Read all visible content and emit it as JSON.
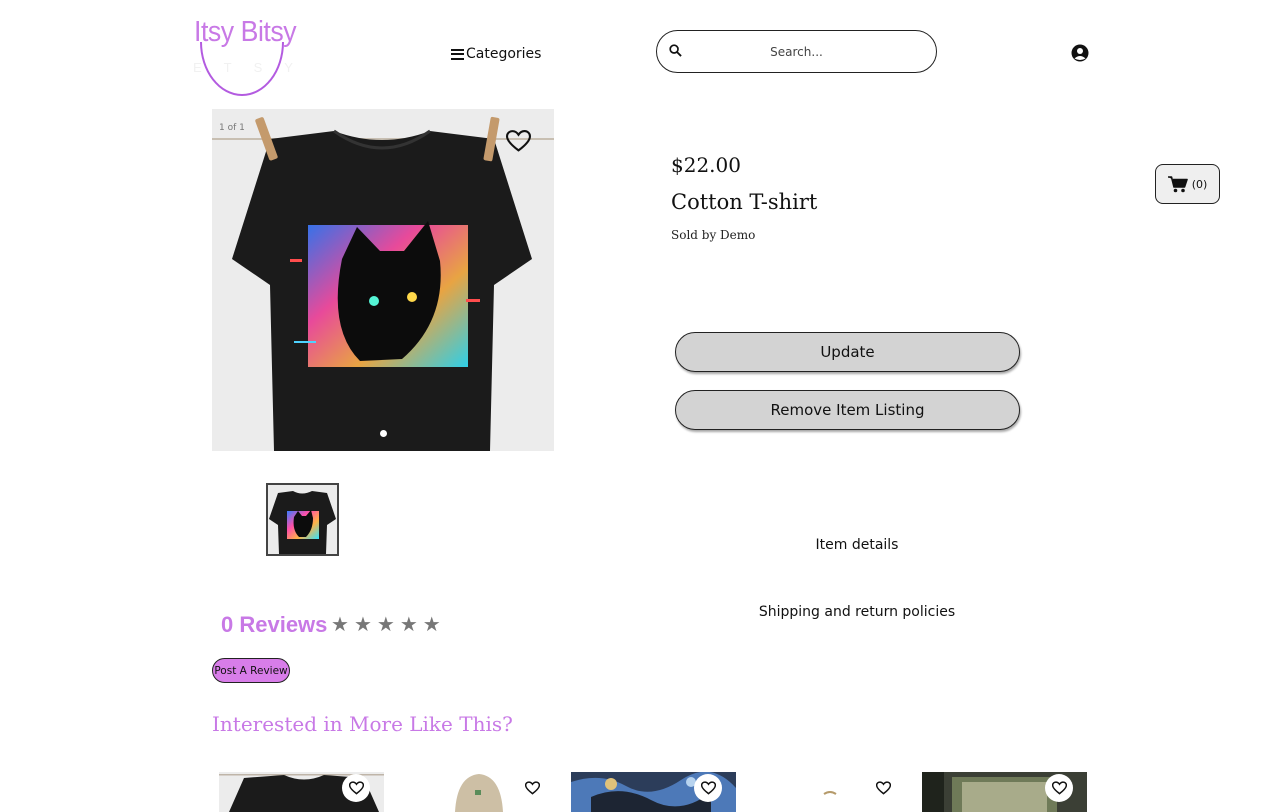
{
  "header": {
    "logo_title": "Itsy Bitsy",
    "logo_subtitle": "ETSY",
    "categories_label": "Categories",
    "search_placeholder": "Search...",
    "cart_count": "(0)"
  },
  "gallery": {
    "counter": "1 of 1"
  },
  "product": {
    "price": "$22.00",
    "title": "Cotton T-shirt",
    "seller": "Sold by Demo"
  },
  "actions": {
    "update_label": "Update",
    "remove_label": "Remove Item Listing"
  },
  "sections": {
    "item_details": "Item details",
    "shipping": "Shipping and return policies"
  },
  "reviews": {
    "count_label": "0 Reviews",
    "rating": 0,
    "max_rating": 5,
    "post_label": "Post A Review"
  },
  "recommendations": {
    "heading": "Interested in More Like This?"
  },
  "colors": {
    "accent": "#c879e6",
    "button_gray": "#d3d3d3",
    "post_review_bg": "#d87de9"
  }
}
